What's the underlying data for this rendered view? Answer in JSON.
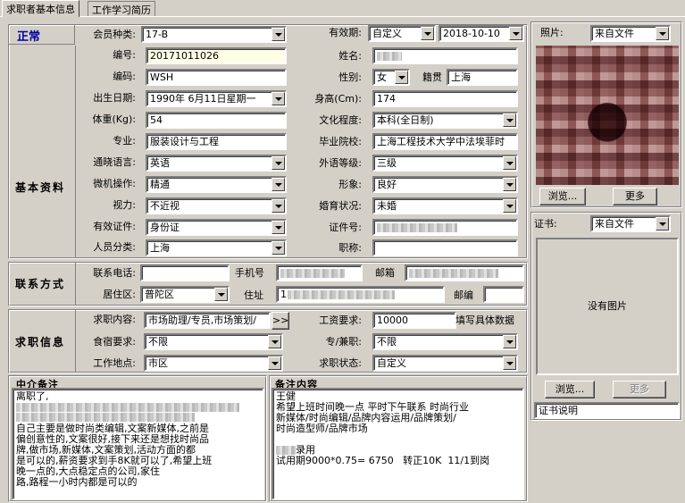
{
  "tabs": [
    "求职者基本信息",
    "工作学习简历"
  ],
  "status": "正常",
  "sections": {
    "basic": "基本资料",
    "contact": "联系方式",
    "job": "求职信息"
  },
  "basic": {
    "member_type_label": "会员种类:",
    "member_type": "17-B",
    "validity_label": "有效期:",
    "validity_type": "自定义",
    "validity_date": "2018-10-10",
    "number_label": "编号:",
    "number": "20171011026",
    "name_label": "姓名:",
    "code_label": "编码:",
    "code": "WSH",
    "gender_label": "性别:",
    "gender": "女",
    "native_label": "籍贯",
    "native": "上海",
    "birth_label": "出生日期:",
    "birth": "1990年 6月11日星期一",
    "height_label": "身高(Cm):",
    "height": "174",
    "weight_label": "体重(Kg):",
    "weight": "54",
    "education_label": "文化程度:",
    "education": "本科(全日制)",
    "major_label": "专业:",
    "major": "服装设计与工程",
    "school_label": "毕业院校:",
    "school": "上海工程技术大学中法埃菲时",
    "language_label": "通晓语言:",
    "language": "英语",
    "foreign_label": "外语等级:",
    "foreign": "三级",
    "computer_label": "微机操作:",
    "computer": "精通",
    "appearance_label": "形象:",
    "appearance": "良好",
    "vision_label": "视力:",
    "vision": "不近视",
    "marriage_label": "婚育状况:",
    "marriage": "未婚",
    "id_type_label": "有效证件:",
    "id_type": "身份证",
    "id_no_label": "证件号:",
    "category_label": "人员分类:",
    "category": "上海",
    "title_label": "职称:"
  },
  "contact": {
    "phone_label": "联系电话:",
    "mobile_label": "手机号",
    "email_label": "邮箱",
    "district_label": "居住区:",
    "district": "普陀区",
    "address_label": "住址",
    "address": "1",
    "postcode_label": "邮编"
  },
  "job": {
    "content_label": "求职内容:",
    "content": "市场助理/专员,市场策划/",
    "more_btn": ">>",
    "salary_label": "工资要求:",
    "salary": "10000",
    "salary_hint": "填写具体数据",
    "board_label": "食宿要求:",
    "board": "不限",
    "parttime_label": "专/兼职:",
    "parttime": "不限",
    "location_label": "工作地点:",
    "location": "市区",
    "state_label": "求职状态:",
    "state": "自定义"
  },
  "photo": {
    "label": "照片:",
    "source": "来自文件",
    "browse": "浏览...",
    "more": "更多"
  },
  "cert": {
    "label": "证书:",
    "source": "来自文件",
    "empty": "没有图片",
    "browse": "浏览...",
    "more": "更多",
    "desc": "证书说明"
  },
  "agent_notes": {
    "title": "中介备注",
    "line1": "离职了,",
    "body": "自己主要是做时尚类编辑,文案新媒体,之前是\n偏创意性的,文案很好,接下来还是想找时尚品\n牌,做市场,新媒体,文案策划,活动方面的都\n是可以的,薪资要求到手8K就可以了,希望上班\n晚一点的,大点稳定点的公司,家住",
    "last": "路,路程一小时内都是可以的"
  },
  "notes": {
    "title": "备注内容",
    "line1": "王健",
    "body": "希望上班时间晚一点 平时下午联系 时尚行业\n新媒体/时尚编辑/品牌内容运用/品牌策划/\n时尚造型师/品牌市场",
    "hired": "录用",
    "trial": "试用期9000*0.75= 6750   转正10K  11/1到岗"
  }
}
